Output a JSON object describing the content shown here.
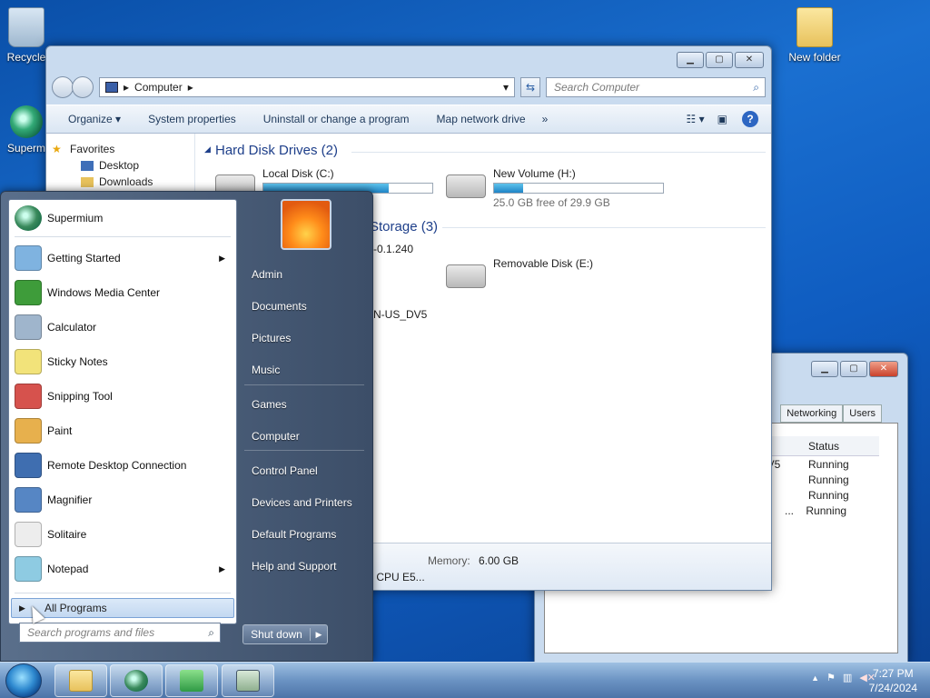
{
  "desktop": {
    "icons": [
      {
        "label": "Recycle"
      },
      {
        "label": "Superm"
      },
      {
        "label": "New folder"
      }
    ]
  },
  "explorer": {
    "address_crumb": "Computer",
    "search_placeholder": "Search Computer",
    "toolbar": {
      "organize": "Organize",
      "system_properties": "System properties",
      "uninstall": "Uninstall or change a program",
      "map_drive": "Map network drive",
      "more": "»"
    },
    "nav": {
      "favorites": "Favorites",
      "desktop": "Desktop",
      "downloads": "Downloads"
    },
    "groups": {
      "hard_disks": "Hard Disk Drives (2)",
      "removable": "Storage (3)"
    },
    "drives": [
      {
        "name": "Local Disk (C:)",
        "used_fraction": 0.74,
        "free_text": ""
      },
      {
        "name": "New Volume (H:)",
        "used_fraction": 0.17,
        "free_text": "25.0 GB free of 29.9 GB"
      },
      {
        "name": "Removable Disk (E:)"
      }
    ],
    "partial_labels": {
      "net_item": "-0.1.240",
      "dvd_item": "N-US_DV5"
    },
    "details": {
      "memory_label": "Memory:",
      "memory_value": "6.00 GB",
      "cpu_partial": ") CPU E5..."
    }
  },
  "task_manager": {
    "tabs": [
      "Networking",
      "Users"
    ],
    "column_status": "Status",
    "rows": [
      {
        "name": "DV5",
        "status": "Running"
      },
      {
        "name": "",
        "status": "Running"
      },
      {
        "name": "",
        "status": "Running"
      },
      {
        "name": "...",
        "status": "Running"
      }
    ]
  },
  "start_menu": {
    "pinned": [
      {
        "label": "Supermium",
        "icon": "supermium-icon",
        "color": "#3a8a5c"
      }
    ],
    "recent": [
      {
        "label": "Getting Started",
        "icon": "getting-started-icon",
        "color": "#7fb3e0",
        "submenu": true
      },
      {
        "label": "Windows Media Center",
        "icon": "media-center-icon",
        "color": "#3e9c3a",
        "submenu": false
      },
      {
        "label": "Calculator",
        "icon": "calculator-icon",
        "color": "#9fb5cc",
        "submenu": false
      },
      {
        "label": "Sticky Notes",
        "icon": "sticky-notes-icon",
        "color": "#f2e37a",
        "submenu": false
      },
      {
        "label": "Snipping Tool",
        "icon": "snipping-tool-icon",
        "color": "#d6524d",
        "submenu": false
      },
      {
        "label": "Paint",
        "icon": "paint-icon",
        "color": "#e7b04d",
        "submenu": false
      },
      {
        "label": "Remote Desktop Connection",
        "icon": "remote-desktop-icon",
        "color": "#3f6eb0",
        "submenu": false
      },
      {
        "label": "Magnifier",
        "icon": "magnifier-icon",
        "color": "#5686c4",
        "submenu": false
      },
      {
        "label": "Solitaire",
        "icon": "solitaire-icon",
        "color": "#ededed",
        "submenu": false
      },
      {
        "label": "Notepad",
        "icon": "notepad-icon",
        "color": "#8ecbe2",
        "submenu": true
      }
    ],
    "all_programs": "All Programs",
    "search_placeholder": "Search programs and files",
    "right": [
      "Admin",
      "Documents",
      "Pictures",
      "Music",
      "Games",
      "Computer",
      "Control Panel",
      "Devices and Printers",
      "Default Programs",
      "Help and Support"
    ],
    "shutdown": "Shut down"
  },
  "taskbar": {
    "time": "7:27 PM",
    "date": "7/24/2024",
    "tray_arrow": "▲"
  }
}
